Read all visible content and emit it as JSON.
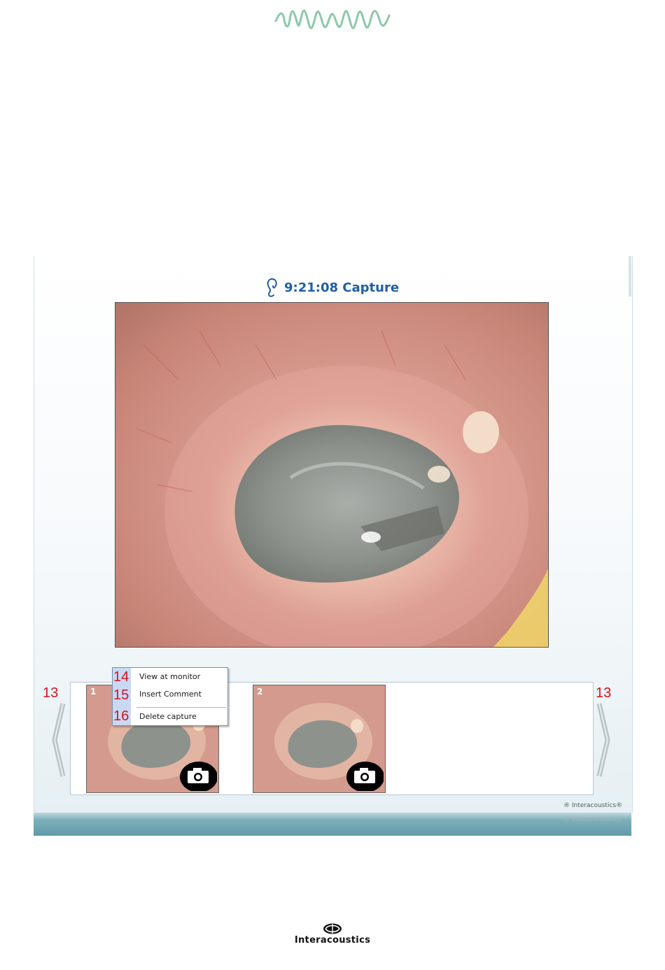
{
  "capture": {
    "title": "9:21:08 Capture",
    "side_icon": "ear-icon"
  },
  "thumbnails": [
    {
      "number": "1",
      "icon": "camera-icon"
    },
    {
      "number": "2",
      "icon": "camera-icon"
    }
  ],
  "context_menu": {
    "items": [
      {
        "callout": "14",
        "label": "View at monitor"
      },
      {
        "callout": "15",
        "label": "Insert Comment"
      },
      {
        "callout": "16",
        "label": "Delete capture"
      }
    ]
  },
  "navigation": {
    "left_callout": "13",
    "right_callout": "13"
  },
  "footer": {
    "copyright": "® Interacoustics®",
    "brand": "Interacoustics"
  },
  "colors": {
    "title_blue": "#1f5fa8",
    "callout_red": "#d6141b",
    "band_teal": "#5f9aa8",
    "wave_green": "#7fbf9f"
  }
}
